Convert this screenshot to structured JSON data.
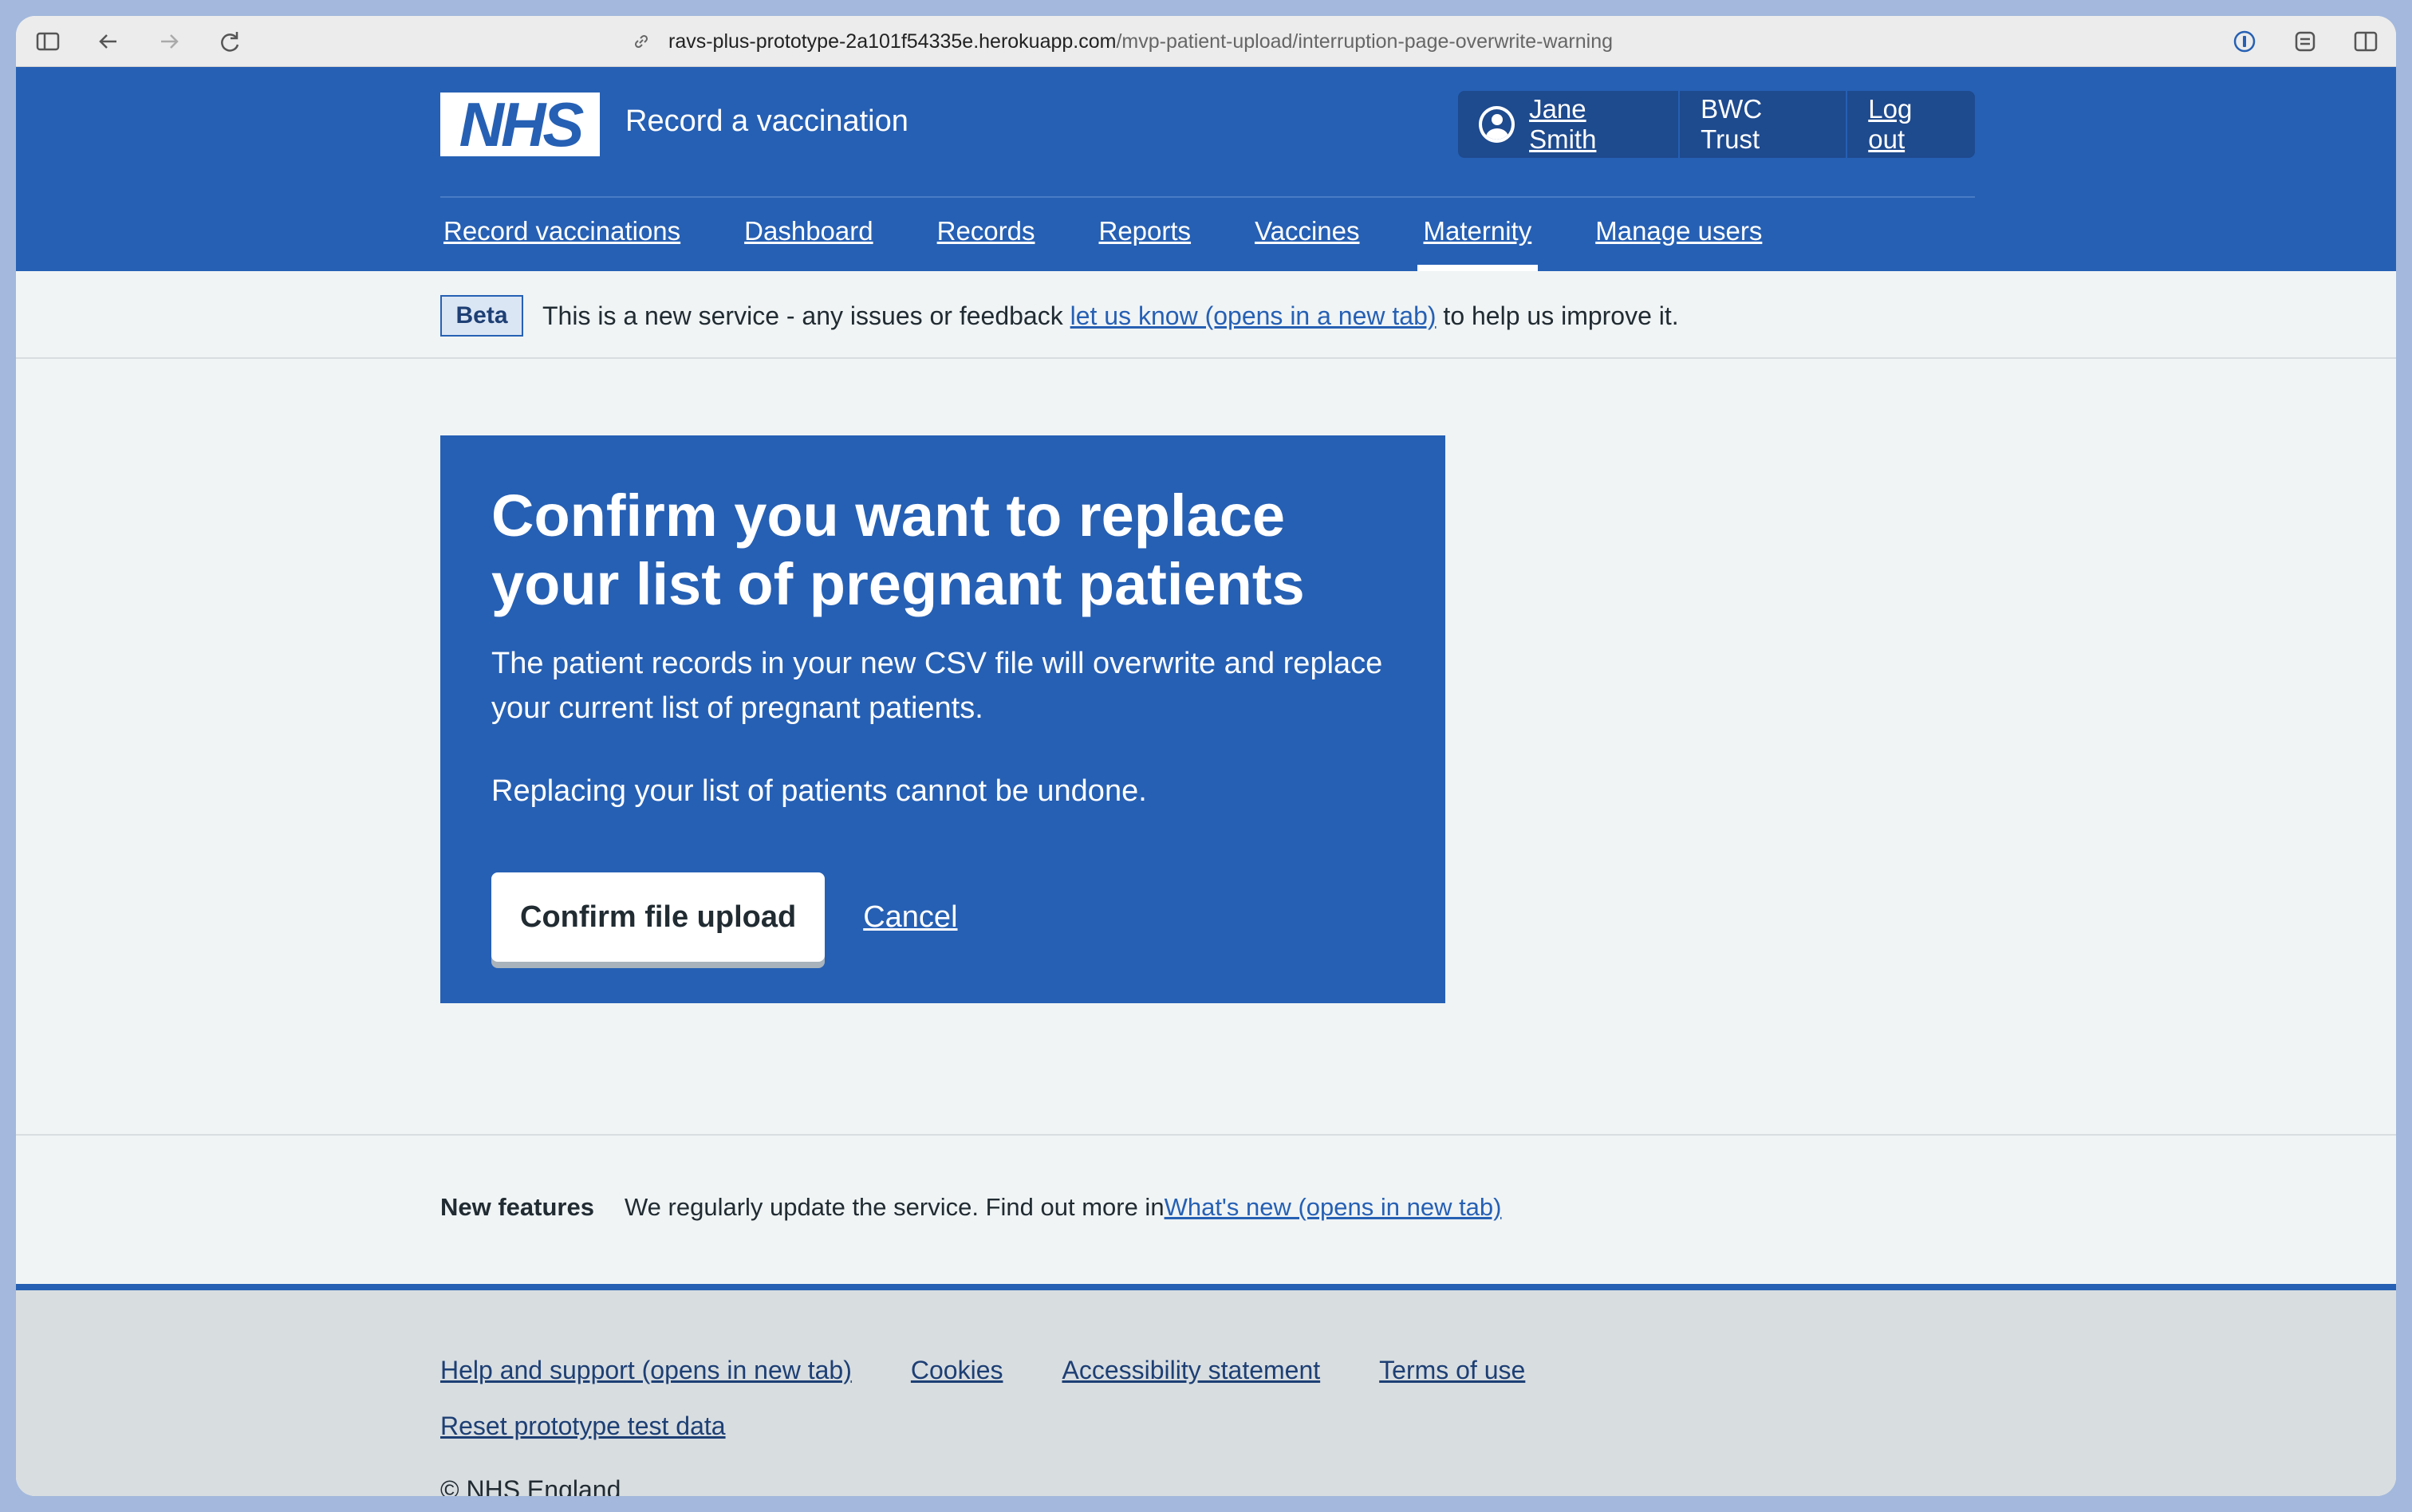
{
  "browser": {
    "url_host": "ravs-plus-prototype-2a101f54335e.herokuapp.com",
    "url_path": "/mvp-patient-upload/interruption-page-overwrite-warning"
  },
  "header": {
    "logo_text": "NHS",
    "service_name": "Record a vaccination",
    "user_name": "Jane Smith",
    "organisation": "BWC Trust",
    "logout_label": "Log out"
  },
  "nav": {
    "items": [
      {
        "label": "Record vaccinations"
      },
      {
        "label": "Dashboard"
      },
      {
        "label": "Records"
      },
      {
        "label": "Reports"
      },
      {
        "label": "Vaccines"
      },
      {
        "label": "Maternity",
        "active": true
      },
      {
        "label": "Manage users"
      }
    ]
  },
  "beta_banner": {
    "tag": "Beta",
    "text_before": "This is a new service - any issues or feedback ",
    "link": "let us know (opens in a new tab)",
    "text_after": " to help us improve it."
  },
  "panel": {
    "title": "Confirm you want to replace your list of pregnant patients",
    "paragraph_1": "The patient records in your new CSV file will overwrite and replace your current list of pregnant patients.",
    "paragraph_2": "Replacing your list of patients cannot be undone.",
    "confirm_button": "Confirm file upload",
    "cancel_link": "Cancel"
  },
  "features": {
    "label": "New features",
    "text": "We regularly update the service. Find out more in ",
    "link": "What's new (opens in new tab)"
  },
  "footer": {
    "links": [
      {
        "label": "Help and support (opens in new tab)"
      },
      {
        "label": "Cookies"
      },
      {
        "label": "Accessibility statement"
      },
      {
        "label": "Terms of use"
      }
    ],
    "reset_link": "Reset prototype test data",
    "copyright": "© NHS England"
  },
  "colors": {
    "nhs_blue": "#2660b4",
    "page_bg": "#f0f4f5",
    "footer_bg": "#d8dde0",
    "text": "#212b32"
  }
}
